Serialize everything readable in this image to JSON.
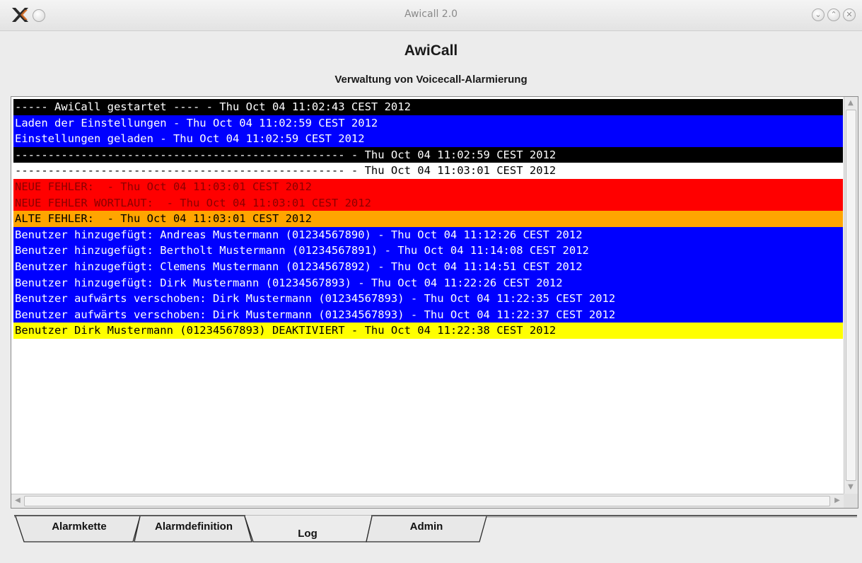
{
  "window": {
    "title": "Awicall 2.0",
    "controls": {
      "minimize": "⌄",
      "maximize": "⌃",
      "close": "✕"
    }
  },
  "header": {
    "title": "AwiCall",
    "subtitle": "Verwaltung von Voicecall-Alarmierung"
  },
  "log": {
    "lines": [
      {
        "text": "----- AwiCall gestartet ---- - Thu Oct 04 11:02:43 CEST 2012",
        "bg": "#000000",
        "fg": "#ffffff"
      },
      {
        "text": "Laden der Einstellungen - Thu Oct 04 11:02:59 CEST 2012",
        "bg": "#0000ff",
        "fg": "#ffffff"
      },
      {
        "text": "Einstellungen geladen - Thu Oct 04 11:02:59 CEST 2012",
        "bg": "#0000ff",
        "fg": "#ffffff"
      },
      {
        "text": "-------------------------------------------------- - Thu Oct 04 11:02:59 CEST 2012",
        "bg": "#000000",
        "fg": "#ffffff"
      },
      {
        "text": "-------------------------------------------------- - Thu Oct 04 11:03:01 CEST 2012",
        "bg": "#ffffff",
        "fg": "#000000"
      },
      {
        "text": "NEUE FEHLER:  - Thu Oct 04 11:03:01 CEST 2012",
        "bg": "#ff0000",
        "fg": "#8b0000"
      },
      {
        "text": "NEUE FEHLER WORTLAUT:  - Thu Oct 04 11:03:01 CEST 2012",
        "bg": "#ff0000",
        "fg": "#8b0000"
      },
      {
        "text": "ALTE FEHLER:  - Thu Oct 04 11:03:01 CEST 2012",
        "bg": "#ffa500",
        "fg": "#000000"
      },
      {
        "text": "Benutzer hinzugefügt: Andreas Mustermann (01234567890) - Thu Oct 04 11:12:26 CEST 2012",
        "bg": "#0000ff",
        "fg": "#ffffff"
      },
      {
        "text": "Benutzer hinzugefügt: Bertholt Mustermann (01234567891) - Thu Oct 04 11:14:08 CEST 2012",
        "bg": "#0000ff",
        "fg": "#ffffff"
      },
      {
        "text": "Benutzer hinzugefügt: Clemens Mustermann (01234567892) - Thu Oct 04 11:14:51 CEST 2012",
        "bg": "#0000ff",
        "fg": "#ffffff"
      },
      {
        "text": "Benutzer hinzugefügt: Dirk Mustermann (01234567893) - Thu Oct 04 11:22:26 CEST 2012",
        "bg": "#0000ff",
        "fg": "#ffffff"
      },
      {
        "text": "Benutzer aufwärts verschoben: Dirk Mustermann (01234567893) - Thu Oct 04 11:22:35 CEST 2012",
        "bg": "#0000ff",
        "fg": "#ffffff"
      },
      {
        "text": "Benutzer aufwärts verschoben: Dirk Mustermann (01234567893) - Thu Oct 04 11:22:37 CEST 2012",
        "bg": "#0000ff",
        "fg": "#ffffff"
      },
      {
        "text": "Benutzer Dirk Mustermann (01234567893) DEAKTIVIERT - Thu Oct 04 11:22:38 CEST 2012",
        "bg": "#ffff00",
        "fg": "#000000"
      }
    ]
  },
  "tabs": [
    {
      "label": "Alarmkette",
      "active": false
    },
    {
      "label": "Alarmdefinition",
      "active": false
    },
    {
      "label": "Log",
      "active": true
    },
    {
      "label": "Admin",
      "active": false
    }
  ],
  "icons": {
    "app": "x-app-icon",
    "pin": "circle-button-icon",
    "scroll_up": "▲",
    "scroll_down": "▼",
    "scroll_left": "◀",
    "scroll_right": "▶"
  }
}
